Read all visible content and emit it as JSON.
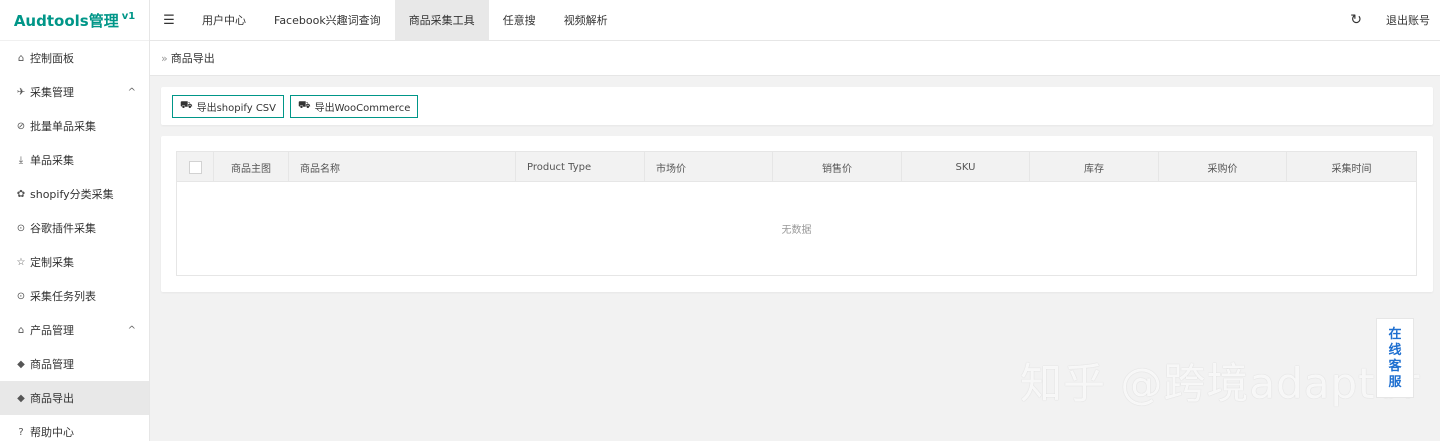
{
  "sidebar": {
    "logo": "Audtools管理",
    "version": "v1",
    "items": [
      {
        "label": "控制面板",
        "icon": "⌂",
        "arrow": ""
      },
      {
        "label": "采集管理",
        "icon": "✈",
        "arrow": "^"
      },
      {
        "label": "批量单品采集",
        "icon": "⊘",
        "arrow": ""
      },
      {
        "label": "单品采集",
        "icon": "⤓",
        "arrow": ""
      },
      {
        "label": "shopify分类采集",
        "icon": "✿",
        "arrow": ""
      },
      {
        "label": "谷歌插件采集",
        "icon": "⊙",
        "arrow": ""
      },
      {
        "label": "定制采集",
        "icon": "☆",
        "arrow": ""
      },
      {
        "label": "采集任务列表",
        "icon": "⊙",
        "arrow": ""
      },
      {
        "label": "产品管理",
        "icon": "⌂",
        "arrow": "^"
      },
      {
        "label": "商品管理",
        "icon": "◆",
        "arrow": ""
      },
      {
        "label": "商品导出",
        "icon": "◆",
        "arrow": ""
      },
      {
        "label": "帮助中心",
        "icon": "?",
        "arrow": ""
      }
    ]
  },
  "header": {
    "menu_icon": "☰",
    "tabs": [
      "用户中心",
      "Facebook兴趣词查询",
      "商品采集工具",
      "任意搜",
      "视频解析"
    ],
    "refresh_icon": "↻",
    "logout": "退出账号"
  },
  "breadcrumb": {
    "sep": "»",
    "current": "商品导出"
  },
  "toolbar": {
    "export_shopify": "导出shopify CSV",
    "export_woo": "导出WooCommerce",
    "export_icon": "⛟"
  },
  "table": {
    "columns": [
      "商品主图",
      "商品名称",
      "Product Type",
      "市场价",
      "销售价",
      "SKU",
      "库存",
      "采购价",
      "采集时间"
    ],
    "empty_text": "无数据"
  },
  "customer_service": [
    "在",
    "线",
    "客",
    "服"
  ],
  "watermark": "知乎 @跨境adaptor",
  "colors": {
    "brand": "#009688",
    "link": "#1e6fd0"
  }
}
